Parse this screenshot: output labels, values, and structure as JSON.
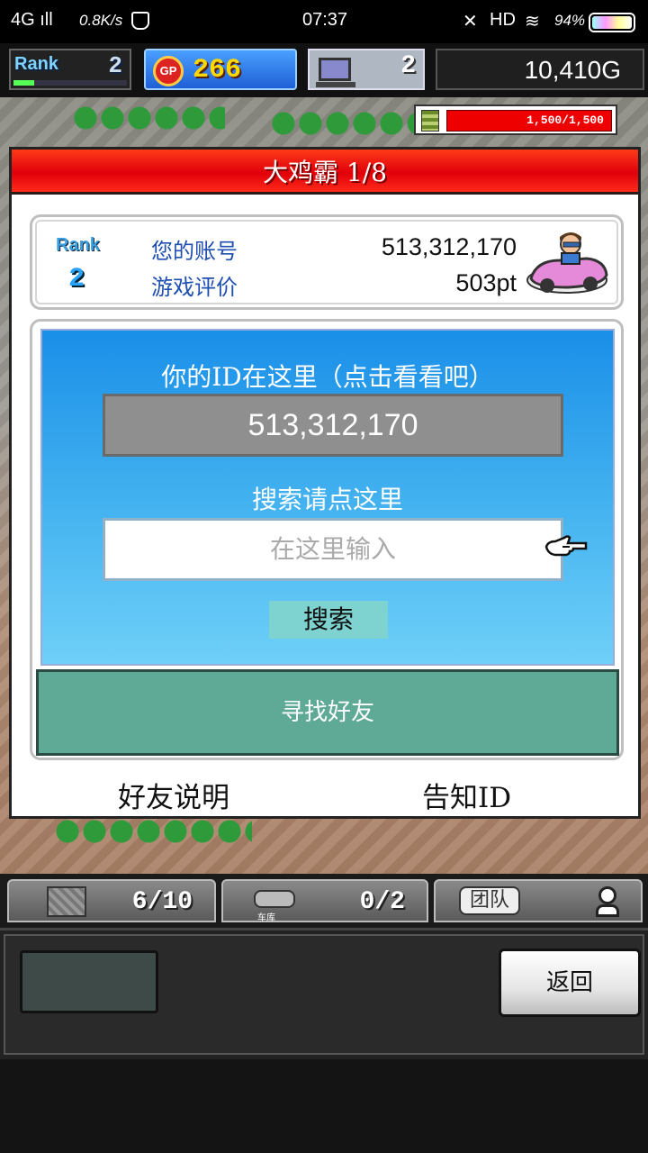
{
  "status_bar": {
    "signal": "4G ıll",
    "speed": "0.8K/s",
    "time": "07:37",
    "mute": "✕",
    "hd": "HD",
    "wifi": "≋",
    "battery": "94%"
  },
  "hud": {
    "rank_label": "Rank",
    "rank": "2",
    "rank_progress": 0.18,
    "gp_icon": "GP",
    "gp": "266",
    "computers": "2",
    "money": "10,410G"
  },
  "stock": {
    "value": "1,500/1,500"
  },
  "dialog": {
    "title": "大鸡霸 1/8",
    "rank_label": "Rank",
    "rank": "2",
    "account_label": "您的账号",
    "account_value": "513,312,170",
    "rating_label": "游戏评价",
    "rating_value": "503pt",
    "id_heading": "你的ID在这里（点击看看吧）",
    "id_value": "513,312,170",
    "search_heading": "搜索请点这里",
    "search_placeholder": "在这里输入",
    "search_button": "搜索",
    "find_friend": "寻找好友",
    "friend_help": "好友说明",
    "tell_id": "告知ID"
  },
  "tabs": {
    "items_count": "6/10",
    "garage_label": "车库",
    "garage_count": "0/2",
    "team_label": "团队"
  },
  "bottom": {
    "back_label": "返回"
  },
  "icons": [
    "gp-coin-icon",
    "computer-icon",
    "coin-stack-icon",
    "car-icon",
    "pointing-hand-icon",
    "crate-icon",
    "garage-car-icon",
    "person-icon",
    "wifi-icon",
    "battery-icon"
  ]
}
